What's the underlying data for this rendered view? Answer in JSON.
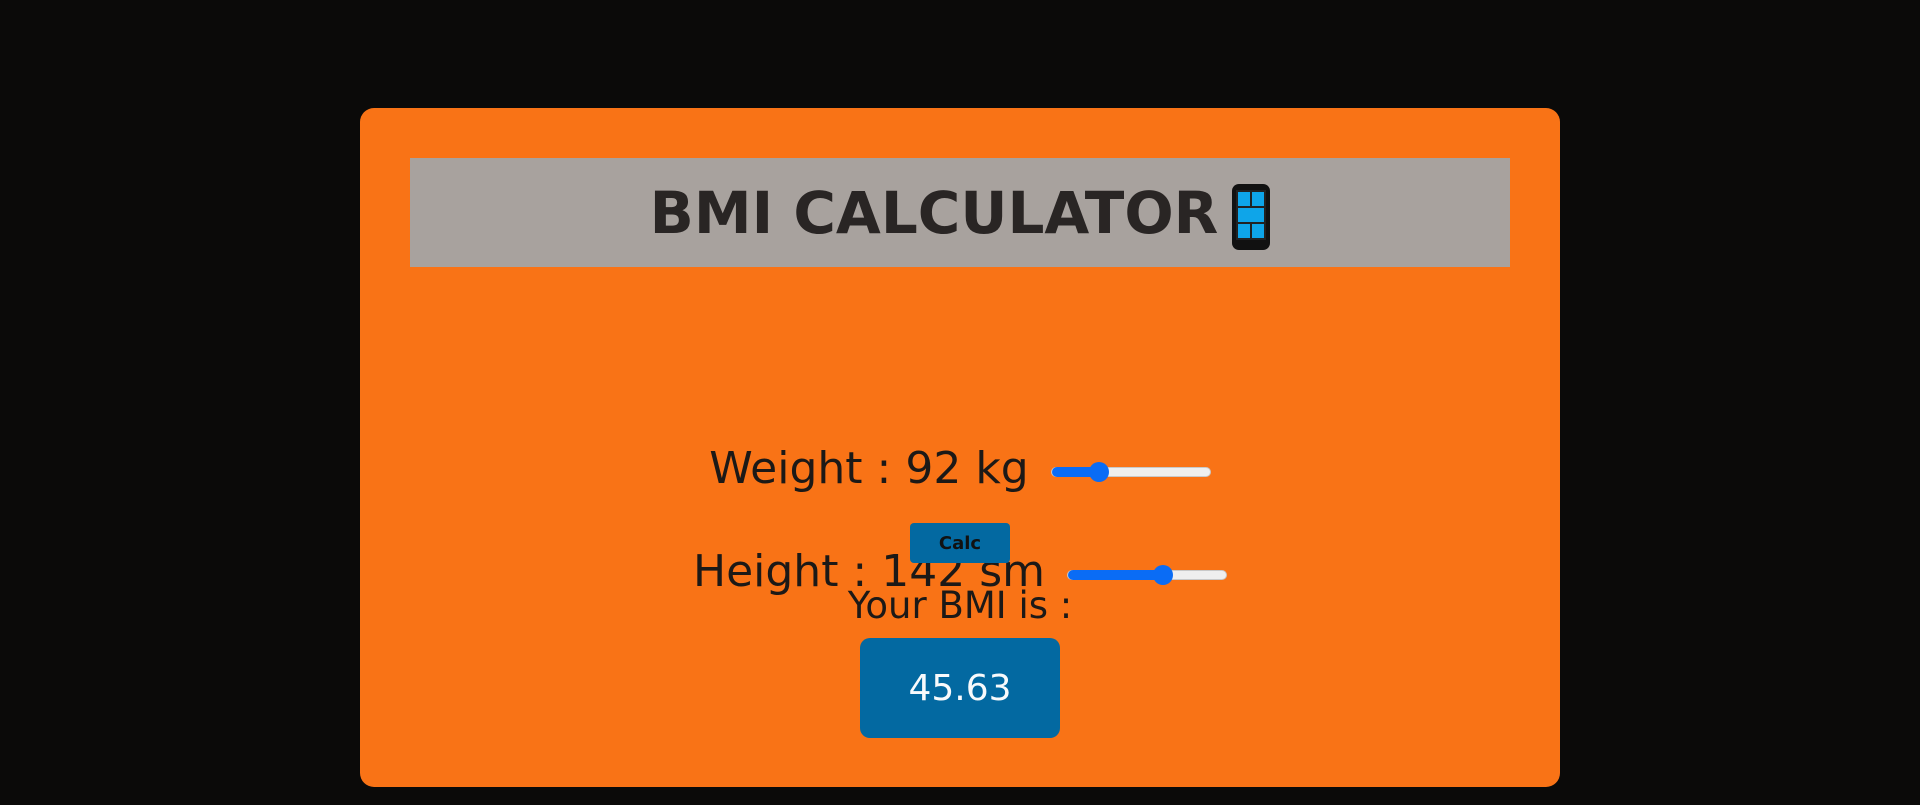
{
  "header": {
    "title": "BMI CALCULATOR",
    "icon": "mobile-phone-icon"
  },
  "weight": {
    "label": "Weight : 92 kg",
    "value": 92,
    "slider_fraction": 0.3
  },
  "height": {
    "label": "Height : 142 sm",
    "value": 142,
    "slider_fraction": 0.6
  },
  "calc_button": {
    "label": "Calc"
  },
  "result": {
    "label": "Your BMI is :",
    "value": "45.63"
  },
  "colors": {
    "background": "#0b0a09",
    "card": "#f97316",
    "header": "#a8a29e",
    "accent": "#0369a1",
    "slider": "#0a6cf5"
  }
}
